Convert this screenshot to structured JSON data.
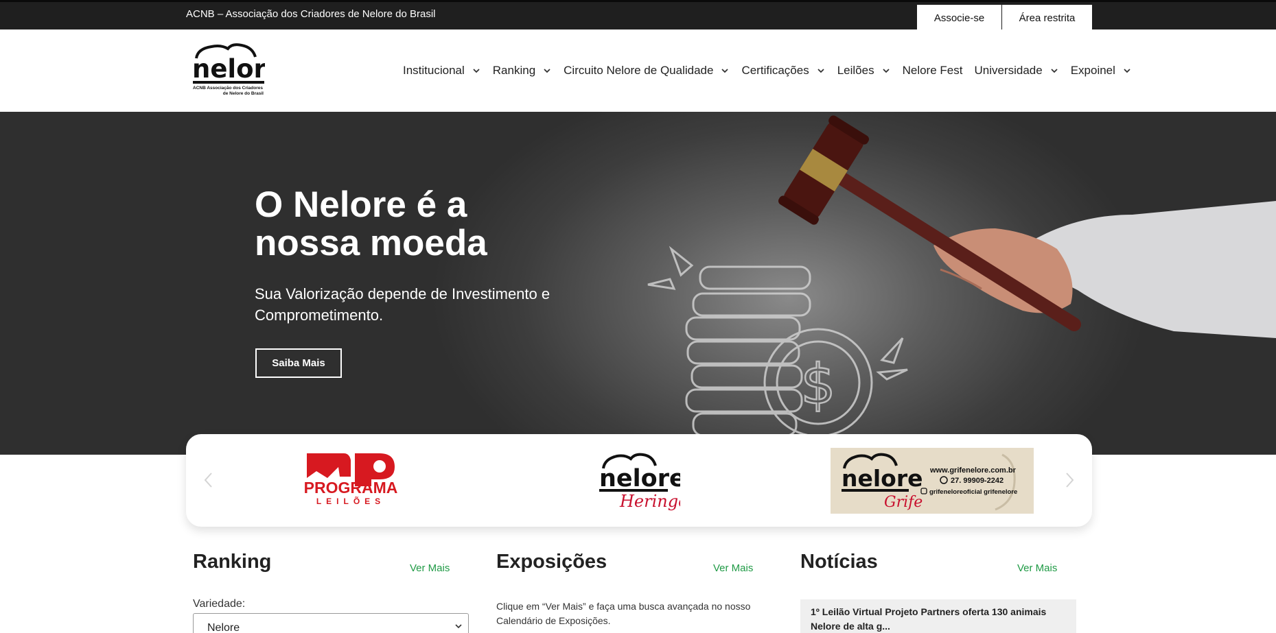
{
  "topbar": {
    "title": "ACNB – Associação dos Criadores de Nelore do Brasil",
    "associe_label": "Associe-se",
    "area_label": "Área restrita"
  },
  "logo": {
    "wordmark": "nelore",
    "caption_line1": "ACNB Associação dos Criadores",
    "caption_line2": "de Nelore do Brasil"
  },
  "nav": {
    "items": [
      {
        "label": "Institucional",
        "dropdown": true
      },
      {
        "label": "Ranking",
        "dropdown": true
      },
      {
        "label": "Circuito Nelore de Qualidade",
        "dropdown": true
      },
      {
        "label": "Certificações",
        "dropdown": true
      },
      {
        "label": "Leilões",
        "dropdown": true
      },
      {
        "label": "Nelore Fest",
        "dropdown": false
      },
      {
        "label": "Universidade",
        "dropdown": true
      },
      {
        "label": "Expoinel",
        "dropdown": true
      }
    ]
  },
  "hero": {
    "title_line1": "O Nelore é a",
    "title_line2": "nossa moeda",
    "subtitle": "Sua Valorização depende de Investimento e Comprometimento.",
    "button_label": "Saiba Mais"
  },
  "sponsors": {
    "programa_word": "PROGRAMA",
    "programa_sub": "LEILÕES",
    "heringer_word": "nelore",
    "heringer_script": "Heringer",
    "grife_word": "nelore",
    "grife_script": "Grife",
    "grife_site": "www.grifenelore.com.br",
    "grife_phone": "27. 99909-2242",
    "grife_social": "grifeneloreoficial  grifenelore"
  },
  "ranking": {
    "title": "Ranking",
    "ver_mais": "Ver Mais",
    "variedade_label": "Variedade:",
    "variedade_value": "Nelore"
  },
  "exposicoes": {
    "title": "Exposições",
    "ver_mais": "Ver Mais",
    "text": "Clique em “Ver Mais” e faça uma busca avançada no nosso Calendário de Exposições."
  },
  "noticias": {
    "title": "Notícias",
    "ver_mais": "Ver Mais",
    "headline": "1º Leilão Virtual Projeto Partners oferta 130 animais Nelore de alta g..."
  },
  "colors": {
    "topbar_bg": "#1f1f1f",
    "accent_green": "#1f9a45",
    "programa_red": "#d71920",
    "heringer_red": "#c8102e"
  }
}
